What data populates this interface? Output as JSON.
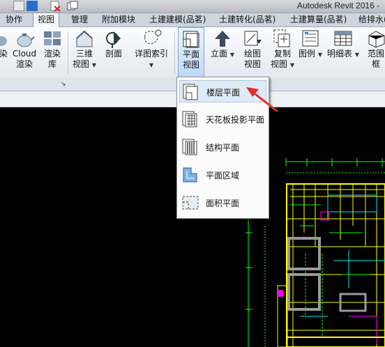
{
  "app_title": "Autodesk Revit 2016 -",
  "tabs": [
    {
      "label": "协作"
    },
    {
      "label": "视图"
    },
    {
      "label": "管理"
    },
    {
      "label": "附加模块"
    },
    {
      "label": "土建建模(品茗)"
    },
    {
      "label": "土建转化(品茗)"
    },
    {
      "label": "土建算量(品茗)"
    },
    {
      "label": "给排水("
    }
  ],
  "ribbon": {
    "render_cut": "染",
    "cloud_render": [
      "Cloud",
      "渲染"
    ],
    "render_gallery": [
      "渲染",
      "库"
    ],
    "view_3d": [
      "三维",
      "视图"
    ],
    "section": "剖面",
    "callout": "详图索引",
    "plan_views": [
      "平面",
      "视图"
    ],
    "elevation": "立面",
    "drafting_view": [
      "绘图",
      "视图"
    ],
    "duplicate_view": [
      "复制",
      "视图"
    ],
    "legends": "图例",
    "schedules": "明细表",
    "scope_box": [
      "范围",
      "框"
    ]
  },
  "plan_menu": {
    "items": [
      {
        "label": "楼层平面"
      },
      {
        "label": "天花板投影平面"
      },
      {
        "label": "结构平面"
      },
      {
        "label": "平面区域"
      },
      {
        "label": "面积平面"
      }
    ]
  },
  "colors": {
    "accent_selected": "#bfd8f6",
    "annotation_arrow": "#e0302a",
    "cad_yellow": "#ffff00",
    "cad_green": "#00ff00",
    "cad_cyan": "#00e5ff",
    "cad_magenta": "#ff00ff"
  }
}
